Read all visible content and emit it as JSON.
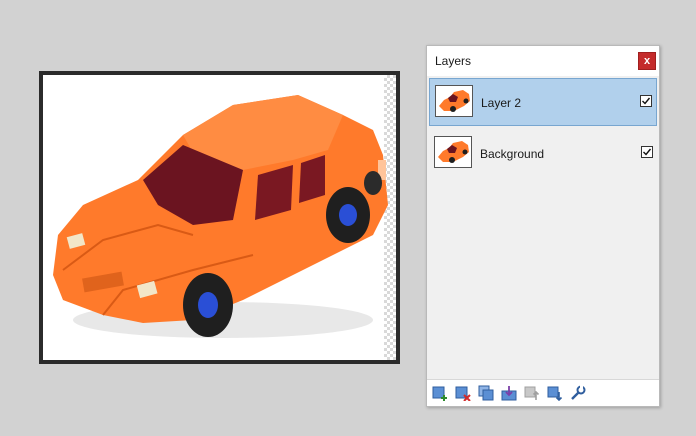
{
  "panel": {
    "title": "Layers",
    "close_label": "x"
  },
  "layers": [
    {
      "name": "Layer 2",
      "visible": true,
      "selected": true
    },
    {
      "name": "Background",
      "visible": true,
      "selected": false
    }
  ],
  "toolbar": {
    "buttons": [
      "add-layer-icon",
      "delete-layer-icon",
      "duplicate-layer-icon",
      "merge-layer-down-icon",
      "move-layer-up-icon",
      "move-layer-down-icon",
      "layer-properties-icon"
    ]
  },
  "colors": {
    "car_body": "#ff7a2b",
    "selection": "#b1d0ec",
    "close_button": "#c42b2b",
    "panel_bg": "#f0f0f0"
  }
}
